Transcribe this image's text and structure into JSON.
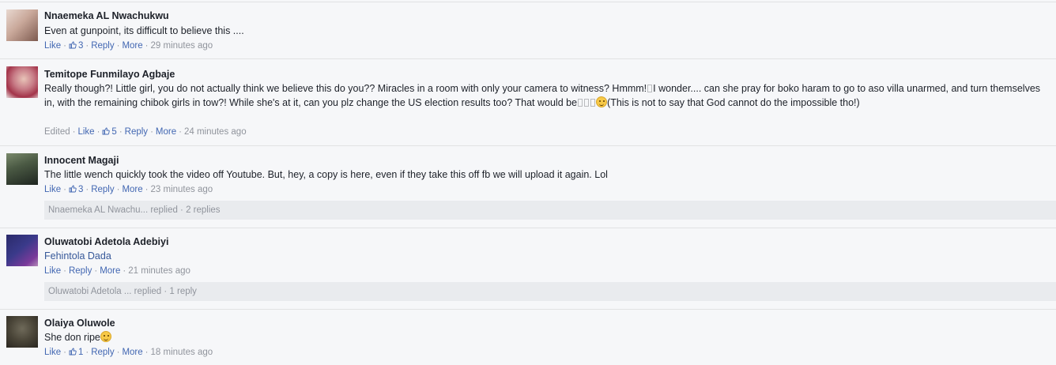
{
  "comments": [
    {
      "author": "Nnaemeka AL Nwachukwu",
      "text": "Even at gunpoint, its difficult to believe this ....",
      "like": "Like",
      "likes": "3",
      "reply": "Reply",
      "more": "More",
      "time": "29 minutes ago",
      "avatar_colors": [
        "#c9a89a",
        "#7d5a4f"
      ]
    },
    {
      "author": "Temitope Funmilayo Agbaje",
      "text_part1": "Really though?! Little girl, you do not actually think we believe this do you?? Miracles in a room with only your camera to witness? Hmmm!",
      "text_part2": "I wonder.... can she pray for boko haram to go to aso villa unarmed, and turn themselves in, with the remaining chibok girls in tow?! While she's at it, can you plz change the US election results too? That would be",
      "text_part3": "(This is not to say that God cannot do the impossible tho!)",
      "edited": "Edited",
      "like": "Like",
      "likes": "5",
      "reply": "Reply",
      "more": "More",
      "time": "24 minutes ago",
      "avatar_colors": [
        "#d9b3b8",
        "#a3344a"
      ]
    },
    {
      "author": "Innocent Magaji",
      "text": "The little wench quickly took the video off Youtube. But, hey, a copy is here, even if they take this off fb we will upload it again. Lol",
      "like": "Like",
      "likes": "3",
      "reply": "Reply",
      "more": "More",
      "time": "23 minutes ago",
      "replies_summary": "Nnaemeka AL Nwachu... replied · 2 replies",
      "avatar_colors": [
        "#4b5a44",
        "#1e2520"
      ]
    },
    {
      "author": "Oluwatobi Adetola Adebiyi",
      "tagged": "Fehintola Dada",
      "like": "Like",
      "reply": "Reply",
      "more": "More",
      "time": "21 minutes ago",
      "replies_summary": "Oluwatobi Adetola ... replied · 1 reply",
      "avatar_colors": [
        "#3a3a8a",
        "#7a3a9a"
      ]
    },
    {
      "author": "Olaiya Oluwole",
      "text": "She don ripe",
      "like": "Like",
      "likes": "1",
      "reply": "Reply",
      "more": "More",
      "time": "18 minutes ago",
      "avatar_colors": [
        "#6f6a5a",
        "#2a2620"
      ]
    }
  ],
  "colors": {
    "link": "#4267b2",
    "meta": "#90949c",
    "background": "#f6f7f9"
  }
}
